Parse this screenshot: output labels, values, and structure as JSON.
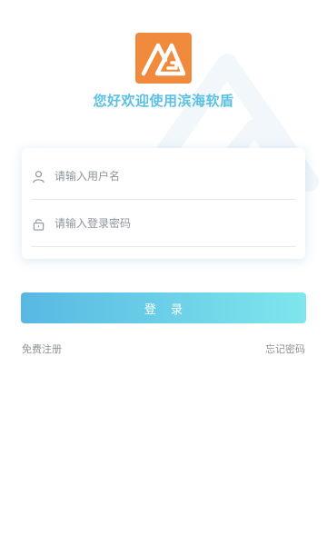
{
  "header": {
    "logo_icon": "brand-logo-icon",
    "welcome": "您好欢迎使用滨海软盾"
  },
  "form": {
    "username": {
      "icon": "user-icon",
      "placeholder": "请输入用户名",
      "value": ""
    },
    "password": {
      "icon": "lock-icon",
      "placeholder": "请输入登录密码",
      "value": ""
    },
    "login_label": "登 录"
  },
  "links": {
    "register": "免费注册",
    "forgot_password": "忘记密码"
  },
  "colors": {
    "logo_orange": "#f08a3c",
    "accent_text": "#5bc0e2",
    "button_gradient_start": "#58b8e3",
    "button_gradient_end": "#7fe6ec",
    "link_gray": "#8c9296"
  }
}
